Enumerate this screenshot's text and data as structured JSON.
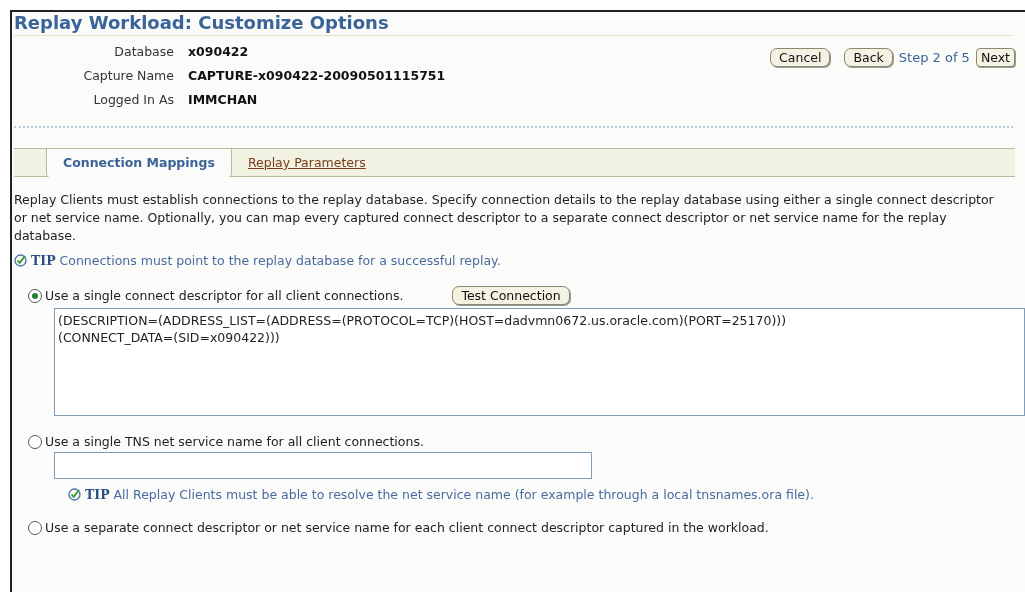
{
  "title": "Replay Workload: Customize Options",
  "info": [
    {
      "label": "Database",
      "value": "x090422"
    },
    {
      "label": "Capture Name",
      "value": "CAPTURE-x090422-20090501115751"
    },
    {
      "label": "Logged In As",
      "value": "IMMCHAN"
    }
  ],
  "nav": {
    "cancel": "Cancel",
    "back": "Back",
    "step": "Step 2 of 5",
    "next": "Next"
  },
  "tabs": [
    {
      "label": "Connection Mappings",
      "selected": true
    },
    {
      "label": "Replay Parameters",
      "selected": false
    }
  ],
  "intro": "Replay Clients must establish connections to the replay database. Specify connection details to the replay database using either a single connect descriptor or net service name. Optionally, you can map every captured connect descriptor to a separate connect descriptor or net service name for the replay database.",
  "tip": {
    "label": "TIP",
    "text": "Connections must point to the replay database for a successful replay."
  },
  "options": [
    {
      "kind": "descriptor",
      "label": "Use a single connect descriptor for all client connections.",
      "selected": true,
      "button": "Test Connection",
      "value": "(DESCRIPTION=(ADDRESS_LIST=(ADDRESS=(PROTOCOL=TCP)(HOST=dadvmn0672.us.oracle.com)(PORT=25170)))\n(CONNECT_DATA=(SID=x090422)))"
    },
    {
      "kind": "service",
      "label": "Use a single TNS net service name for all client connections.",
      "selected": false,
      "tip": {
        "label": "TIP",
        "text": "All Replay Clients must be able to resolve the net service name (for example through a local tnsnames.ora file)."
      }
    },
    {
      "kind": "plain",
      "label": "Use a separate connect descriptor or net service name for each client connect descriptor captured in the workload.",
      "selected": false
    }
  ]
}
